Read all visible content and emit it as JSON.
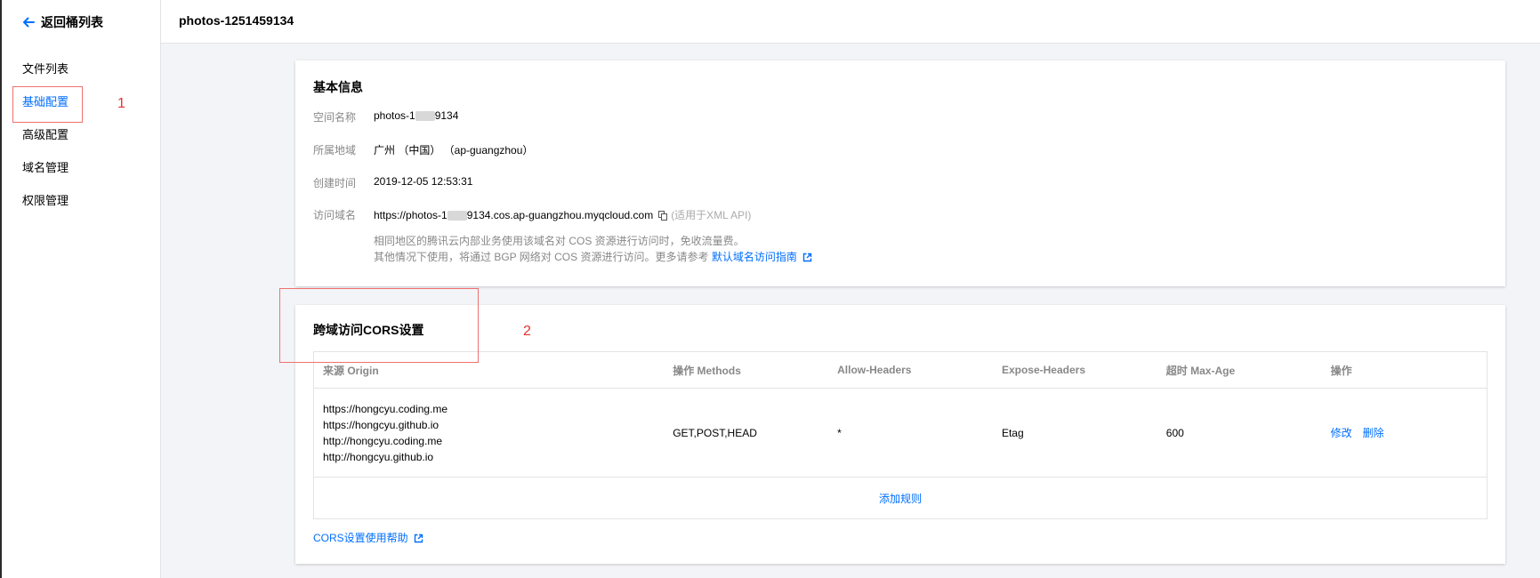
{
  "sidebar": {
    "back_label": "返回桶列表",
    "items": [
      {
        "label": "文件列表"
      },
      {
        "label": "基础配置",
        "active": true
      },
      {
        "label": "高级配置"
      },
      {
        "label": "域名管理"
      },
      {
        "label": "权限管理"
      }
    ]
  },
  "header": {
    "title": "photos-1251459134"
  },
  "basic_info": {
    "title": "基本信息",
    "rows": [
      {
        "label": "空间名称",
        "value_prefix": "photos-1",
        "value_suffix": "9134"
      },
      {
        "label": "所属地域",
        "value": "广州 （中国） （ap-guangzhou）"
      },
      {
        "label": "创建时间",
        "value": "2019-12-05 12:53:31"
      },
      {
        "label": "访问域名",
        "value_prefix": "https://photos-1",
        "value_suffix": "9134.cos.ap-guangzhou.myqcloud.com",
        "hint": "(适用于XML API)"
      }
    ],
    "note_line1": "相同地区的腾讯云内部业务使用该域名对 COS 资源进行访问时，免收流量费。",
    "note_line2": "其他情况下使用，将通过 BGP 网络对 COS 资源进行访问。更多请参考",
    "note_link": "默认域名访问指南"
  },
  "cors": {
    "title": "跨域访问CORS设置",
    "columns": [
      "来源 Origin",
      "操作 Methods",
      "Allow-Headers",
      "Expose-Headers",
      "超时 Max-Age",
      "操作"
    ],
    "rows": [
      {
        "origins": [
          "https://hongcyu.coding.me",
          "https://hongcyu.github.io",
          "http://hongcyu.coding.me",
          "http://hongcyu.github.io"
        ],
        "methods": "GET,POST,HEAD",
        "allow_headers": "*",
        "expose_headers": "Etag",
        "max_age": "600",
        "edit_label": "修改",
        "delete_label": "删除"
      }
    ],
    "add_rule_label": "添加规则",
    "help_link": "CORS设置使用帮助"
  },
  "annotations": [
    "1",
    "2"
  ],
  "colors": {
    "accent": "#006eff",
    "annotation": "#e83030"
  }
}
